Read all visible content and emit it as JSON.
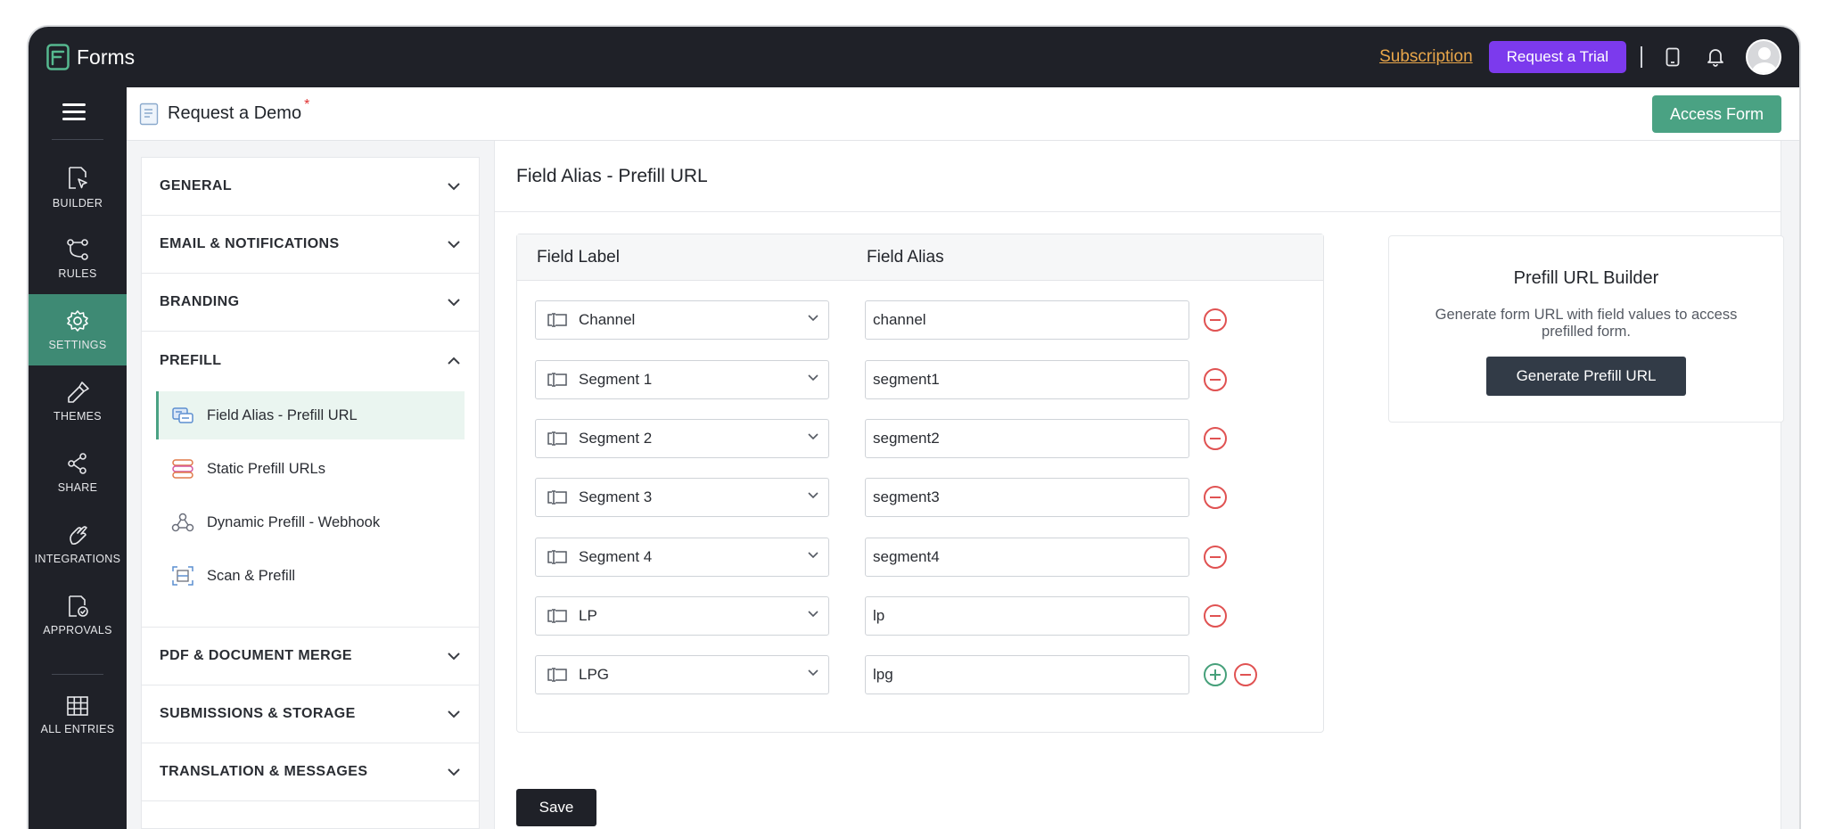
{
  "topbar": {
    "app_name": "Forms",
    "subscription": "Subscription",
    "trial_button": "Request a Trial"
  },
  "leftnav": {
    "items": [
      {
        "label": "BUILDER",
        "icon": "builder-icon"
      },
      {
        "label": "RULES",
        "icon": "rules-icon"
      },
      {
        "label": "SETTINGS",
        "icon": "gear-icon",
        "active": true
      },
      {
        "label": "THEMES",
        "icon": "themes-icon"
      },
      {
        "label": "SHARE",
        "icon": "share-icon"
      },
      {
        "label": "INTEGRATIONS",
        "icon": "integrations-icon"
      },
      {
        "label": "APPROVALS",
        "icon": "approvals-icon"
      },
      {
        "label": "ALL ENTRIES",
        "icon": "table-icon"
      }
    ]
  },
  "subheader": {
    "form_title": "Request a Demo",
    "unsaved_marker": "*",
    "access_button": "Access Form"
  },
  "settings": {
    "sections": [
      {
        "label": "GENERAL"
      },
      {
        "label": "EMAIL & NOTIFICATIONS"
      },
      {
        "label": "BRANDING"
      },
      {
        "label": "PREFILL",
        "expanded": true
      },
      {
        "label": "PDF & DOCUMENT MERGE"
      },
      {
        "label": "SUBMISSIONS & STORAGE"
      },
      {
        "label": "TRANSLATION & MESSAGES"
      }
    ],
    "prefill_items": [
      {
        "label": "Field Alias - Prefill URL",
        "active": true
      },
      {
        "label": "Static Prefill URLs"
      },
      {
        "label": "Dynamic Prefill - Webhook"
      },
      {
        "label": "Scan & Prefill"
      }
    ]
  },
  "main": {
    "title": "Field Alias - Prefill URL",
    "columns": [
      "Field Label",
      "Field Alias"
    ],
    "rows": [
      {
        "label": "Channel",
        "alias": "channel"
      },
      {
        "label": "Segment 1",
        "alias": "segment1"
      },
      {
        "label": "Segment 2",
        "alias": "segment2"
      },
      {
        "label": "Segment 3",
        "alias": "segment3"
      },
      {
        "label": "Segment 4",
        "alias": "segment4"
      },
      {
        "label": "LP",
        "alias": "lp"
      },
      {
        "label": "LPG",
        "alias": "lpg"
      }
    ],
    "save_button": "Save"
  },
  "builder": {
    "title": "Prefill URL Builder",
    "description": "Generate form URL with field values to access prefilled form.",
    "button": "Generate Prefill URL"
  },
  "colors": {
    "accent": "#4aa283",
    "trial": "#7c3aed",
    "dark": "#1f2128",
    "remove": "#e05252"
  }
}
